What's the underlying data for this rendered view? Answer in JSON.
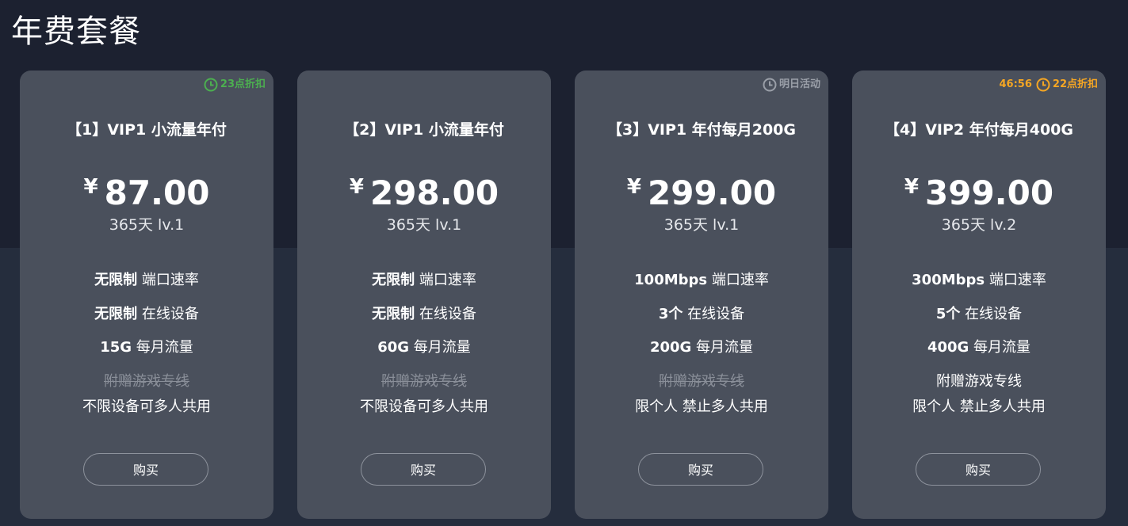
{
  "page": {
    "title": "年费套餐"
  },
  "colors": {
    "green": "#4caf50",
    "gray": "#9a9fa8",
    "orange": "#f5a623"
  },
  "plans": [
    {
      "promo": {
        "countdown": "",
        "label": "23点折扣",
        "color": "#4caf50",
        "icon": "clock-icon"
      },
      "title": "【1】VIP1 小流量年付",
      "currency": "¥",
      "price": "87.00",
      "duration": "365天 lv.1",
      "features": [
        {
          "value": "无限制",
          "label": "端口速率"
        },
        {
          "value": "无限制",
          "label": "在线设备"
        },
        {
          "value": "15G",
          "label": "每月流量"
        }
      ],
      "extra": "附赠游戏专线",
      "extra_enabled": false,
      "sharing": "不限设备可多人共用",
      "buy_label": "购买"
    },
    {
      "promo": {
        "countdown": "",
        "label": "",
        "color": "",
        "icon": ""
      },
      "title": "【2】VIP1 小流量年付",
      "currency": "¥",
      "price": "298.00",
      "duration": "365天 lv.1",
      "features": [
        {
          "value": "无限制",
          "label": "端口速率"
        },
        {
          "value": "无限制",
          "label": "在线设备"
        },
        {
          "value": "60G",
          "label": "每月流量"
        }
      ],
      "extra": "附赠游戏专线",
      "extra_enabled": false,
      "sharing": "不限设备可多人共用",
      "buy_label": "购买"
    },
    {
      "promo": {
        "countdown": "",
        "label": "明日活动",
        "color": "#9a9fa8",
        "icon": "clock-icon"
      },
      "title": "【3】VIP1 年付每月200G",
      "currency": "¥",
      "price": "299.00",
      "duration": "365天 lv.1",
      "features": [
        {
          "value": "100Mbps",
          "label": "端口速率"
        },
        {
          "value": "3个",
          "label": "在线设备"
        },
        {
          "value": "200G",
          "label": "每月流量"
        }
      ],
      "extra": "附赠游戏专线",
      "extra_enabled": false,
      "sharing": "限个人 禁止多人共用",
      "buy_label": "购买"
    },
    {
      "promo": {
        "countdown": "46:56",
        "label": "22点折扣",
        "color": "#f5a623",
        "icon": "clock-icon"
      },
      "title": "【4】VIP2 年付每月400G",
      "currency": "¥",
      "price": "399.00",
      "duration": "365天 lv.2",
      "features": [
        {
          "value": "300Mbps",
          "label": "端口速率"
        },
        {
          "value": "5个",
          "label": "在线设备"
        },
        {
          "value": "400G",
          "label": "每月流量"
        }
      ],
      "extra": "附赠游戏专线",
      "extra_enabled": true,
      "sharing": "限个人 禁止多人共用",
      "buy_label": "购买"
    }
  ]
}
